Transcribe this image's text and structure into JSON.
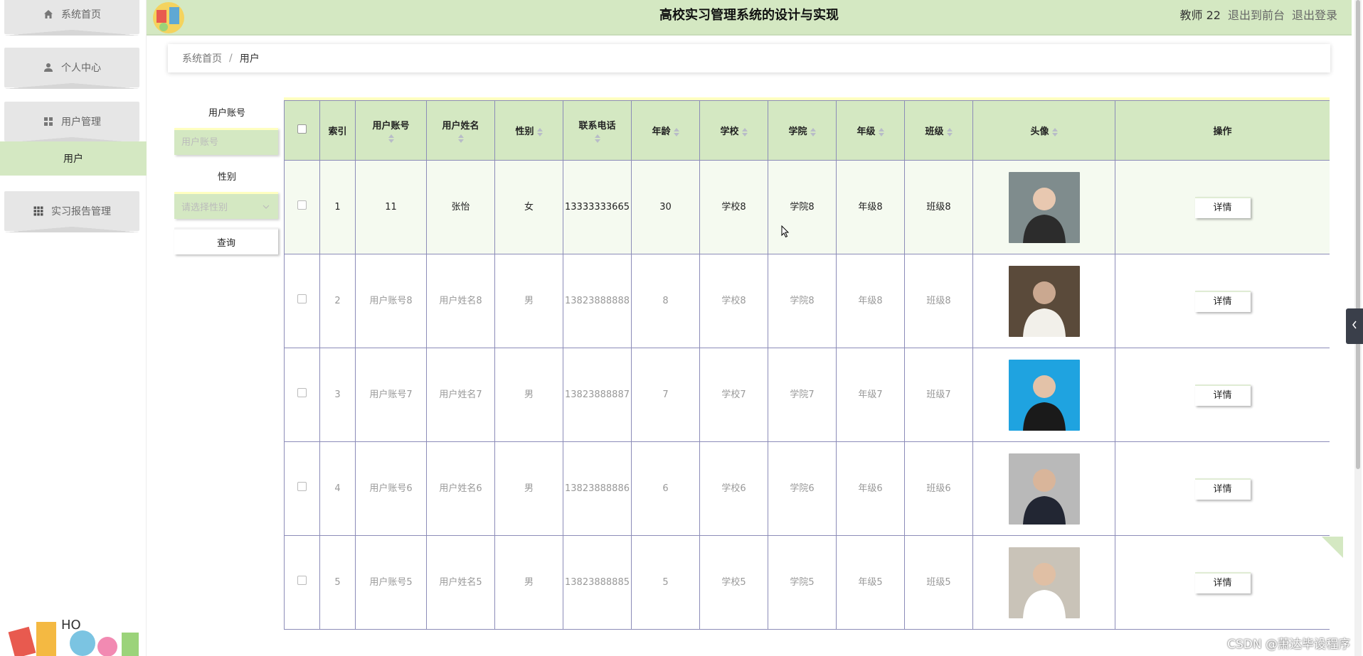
{
  "header": {
    "title": "高校实习管理系统的设计与实现",
    "user": "教师 22",
    "to_front": "退出到前台",
    "logout": "退出登录"
  },
  "sidebar": {
    "items": [
      {
        "label": "系统首页",
        "icon": "home-icon"
      },
      {
        "label": "个人中心",
        "icon": "person-icon"
      },
      {
        "label": "用户管理",
        "icon": "grid-icon"
      },
      {
        "label": "实习报告管理",
        "icon": "apps-icon"
      }
    ],
    "active_sub": "用户"
  },
  "breadcrumb": {
    "home": "系统首页",
    "sep": "/",
    "current": "用户"
  },
  "search": {
    "account_label": "用户账号",
    "account_placeholder": "用户账号",
    "gender_label": "性别",
    "gender_placeholder": "请选择性别",
    "query_button": "查询"
  },
  "table": {
    "headers": [
      "索引",
      "用户账号",
      "用户姓名",
      "性别",
      "联系电话",
      "年龄",
      "学校",
      "学院",
      "年级",
      "班级",
      "头像",
      "操作"
    ],
    "rows": [
      {
        "index": "1",
        "account": "11",
        "name": "张怡",
        "gender": "女",
        "phone": "13333333665",
        "age": "30",
        "school": "学校8",
        "college": "学院8",
        "grade": "年级8",
        "class": "班级8",
        "action": "详情"
      },
      {
        "index": "2",
        "account": "用户账号8",
        "name": "用户姓名8",
        "gender": "男",
        "phone": "13823888888",
        "age": "8",
        "school": "学校8",
        "college": "学院8",
        "grade": "年级8",
        "class": "班级8",
        "action": "详情"
      },
      {
        "index": "3",
        "account": "用户账号7",
        "name": "用户姓名7",
        "gender": "男",
        "phone": "13823888887",
        "age": "7",
        "school": "学校7",
        "college": "学院7",
        "grade": "年级7",
        "class": "班级7",
        "action": "详情"
      },
      {
        "index": "4",
        "account": "用户账号6",
        "name": "用户姓名6",
        "gender": "男",
        "phone": "13823888886",
        "age": "6",
        "school": "学校6",
        "college": "学院6",
        "grade": "年级6",
        "class": "班级6",
        "action": "详情"
      },
      {
        "index": "5",
        "account": "用户账号5",
        "name": "用户姓名5",
        "gender": "男",
        "phone": "13823888885",
        "age": "5",
        "school": "学校5",
        "college": "学院5",
        "grade": "年级5",
        "class": "班级5",
        "action": "详情"
      }
    ]
  },
  "watermark": "CSDN @萧达毕设程序",
  "colors": {
    "accent": "#d4e8c2",
    "border": "#8c8cb8",
    "highlight": "#ffffc0"
  }
}
